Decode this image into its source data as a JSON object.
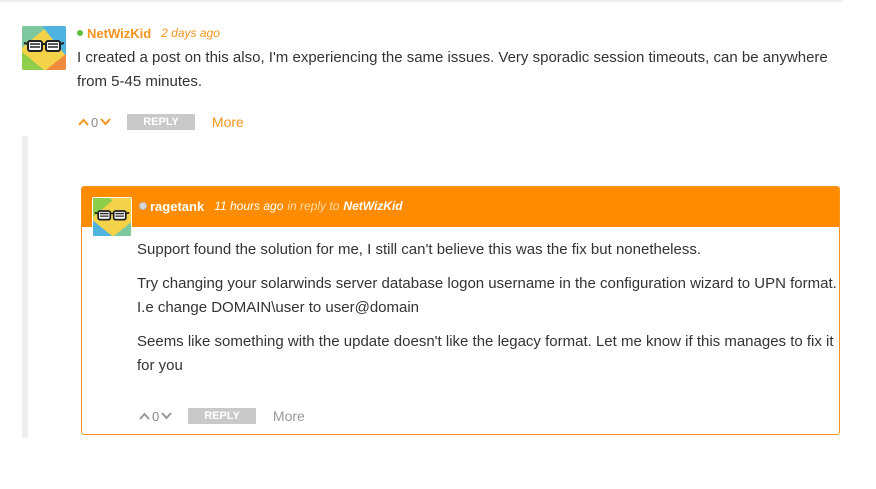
{
  "comments": [
    {
      "author": "NetWizKid",
      "time": "2 days ago",
      "text": "I created a post on this also, I'm experiencing the same issues. Very sporadic session timeouts, can be anywhere from 5-45 minutes.",
      "votes": "0",
      "reply_label": "REPLY",
      "more_label": "More",
      "online": true
    }
  ],
  "reply": {
    "author": "ragetank",
    "time": "11 hours ago",
    "in_reply_to_label": "in reply to",
    "in_reply_to": "NetWizKid",
    "paragraphs": [
      "Support found the solution for me, I still can't believe this was the fix but nonetheless.",
      "Try changing your solarwinds server database logon username in the configuration wizard to UPN format. I.e change DOMAIN\\user to user@domain",
      "Seems like something with the update doesn't like the legacy format. Let me know if this manages to fix it for you"
    ],
    "votes": "0",
    "reply_label": "REPLY",
    "more_label": "More",
    "online": false
  },
  "colors": {
    "accent": "#f7941d",
    "reply_header": "#ff8c00",
    "online_dot": "#5fbf3c",
    "button_gray": "#c9c9c9"
  }
}
